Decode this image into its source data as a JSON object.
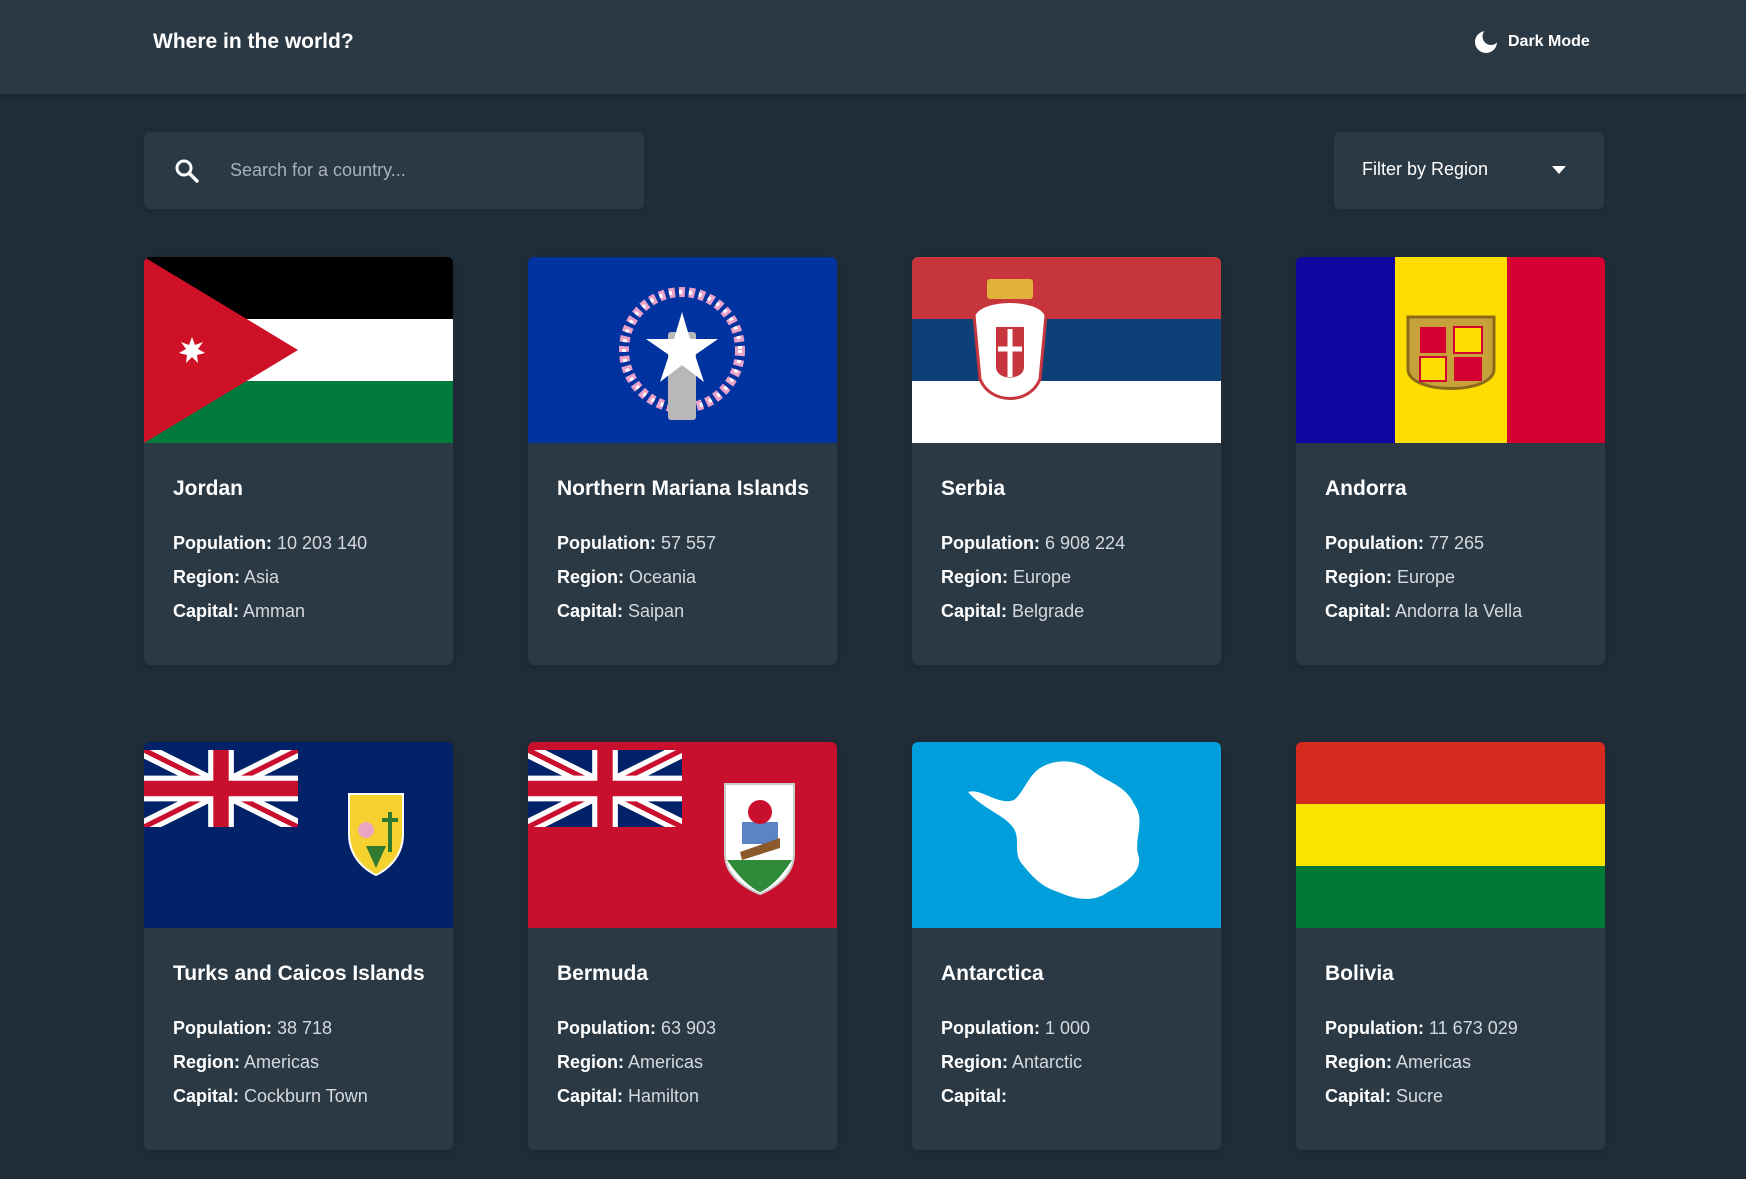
{
  "header": {
    "title": "Where in the world?",
    "mode_toggle": {
      "label": "Dark Mode",
      "icon": "moon-icon"
    }
  },
  "search": {
    "placeholder": "Search for a country...",
    "value": "",
    "icon": "search-icon"
  },
  "filter": {
    "label": "Filter by Region",
    "icon": "chevron-down-icon"
  },
  "labels": {
    "population": "Population:",
    "region": "Region:",
    "capital": "Capital:"
  },
  "colors": {
    "background": "#202c37",
    "surface": "#2b3945",
    "text": "#ffffff"
  },
  "countries": [
    {
      "name": "Jordan",
      "population": "10 203 140",
      "region": "Asia",
      "capital": "Amman",
      "flag": "jordan-flag"
    },
    {
      "name": "Northern Mariana Islands",
      "population": "57 557",
      "region": "Oceania",
      "capital": "Saipan",
      "flag": "northern-mariana-islands-flag"
    },
    {
      "name": "Serbia",
      "population": "6 908 224",
      "region": "Europe",
      "capital": "Belgrade",
      "flag": "serbia-flag"
    },
    {
      "name": "Andorra",
      "population": "77 265",
      "region": "Europe",
      "capital": "Andorra la Vella",
      "flag": "andorra-flag"
    },
    {
      "name": "Turks and Caicos Islands",
      "population": "38 718",
      "region": "Americas",
      "capital": "Cockburn Town",
      "flag": "turks-and-caicos-flag"
    },
    {
      "name": "Bermuda",
      "population": "63 903",
      "region": "Americas",
      "capital": "Hamilton",
      "flag": "bermuda-flag"
    },
    {
      "name": "Antarctica",
      "population": "1 000",
      "region": "Antarctic",
      "capital": "",
      "flag": "antarctica-flag"
    },
    {
      "name": "Bolivia",
      "population": "11 673 029",
      "region": "Americas",
      "capital": "Sucre",
      "flag": "bolivia-flag"
    }
  ]
}
